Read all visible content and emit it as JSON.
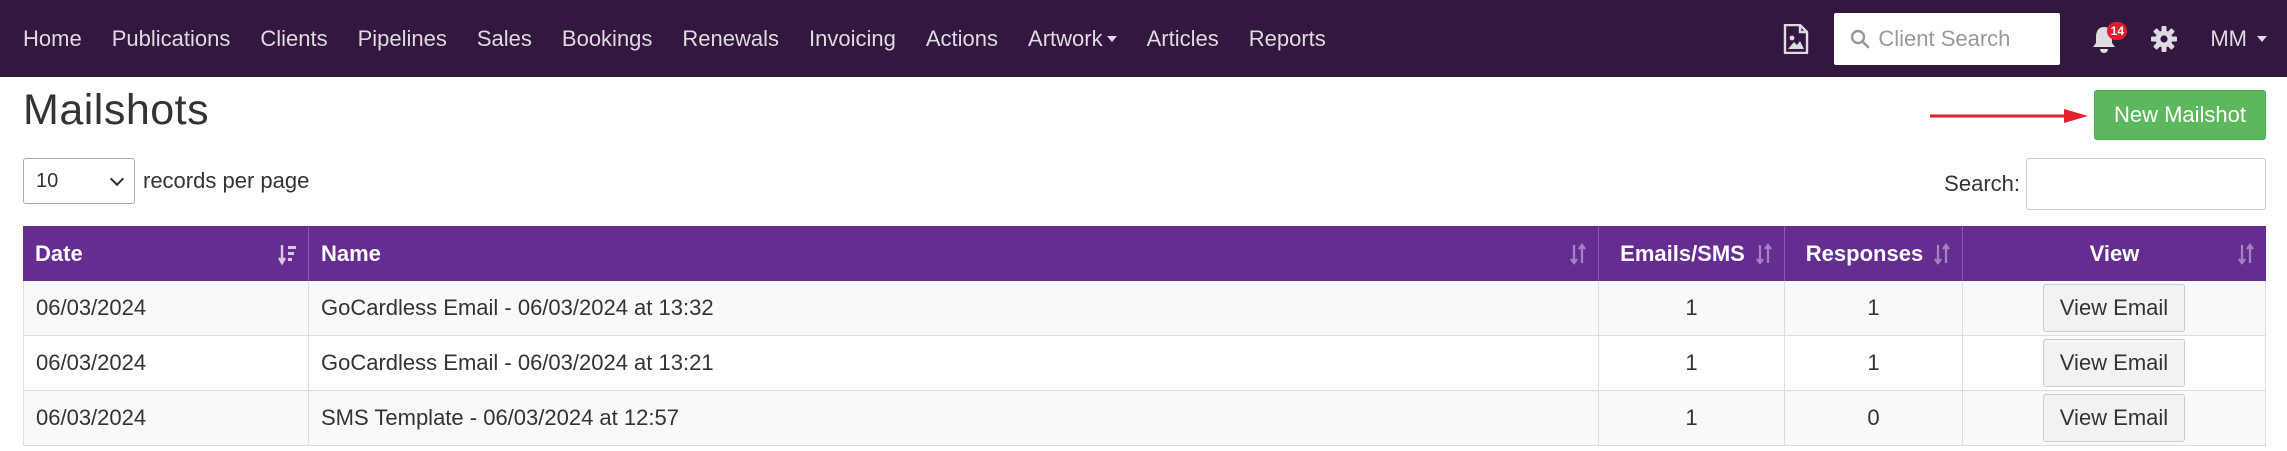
{
  "nav": {
    "items": [
      {
        "label": "Home"
      },
      {
        "label": "Publications"
      },
      {
        "label": "Clients"
      },
      {
        "label": "Pipelines"
      },
      {
        "label": "Sales"
      },
      {
        "label": "Bookings"
      },
      {
        "label": "Renewals"
      },
      {
        "label": "Invoicing"
      },
      {
        "label": "Actions"
      },
      {
        "label": "Artwork",
        "has_dropdown": true
      },
      {
        "label": "Articles"
      },
      {
        "label": "Reports"
      }
    ],
    "client_search_placeholder": "Client Search",
    "notification_count": "14",
    "user_initials": "MM",
    "icons": [
      "image-file-icon",
      "search-icon",
      "bell-icon",
      "gear-icon"
    ]
  },
  "page": {
    "title": "Mailshots",
    "new_button": "New Mailshot"
  },
  "controls": {
    "length_value": "10",
    "length_label": "records per page",
    "search_label": "Search:"
  },
  "table": {
    "headers": [
      "Date",
      "Name",
      "Emails/SMS",
      "Responses",
      "View"
    ],
    "rows": [
      {
        "date": "06/03/2024",
        "name": "GoCardless Email - 06/03/2024 at 13:32",
        "emails": "1",
        "responses": "1",
        "view": "View Email"
      },
      {
        "date": "06/03/2024",
        "name": "GoCardless Email - 06/03/2024 at 13:21",
        "emails": "1",
        "responses": "1",
        "view": "View Email"
      },
      {
        "date": "06/03/2024",
        "name": "SMS Template - 06/03/2024 at 12:57",
        "emails": "1",
        "responses": "0",
        "view": "View Email"
      }
    ]
  },
  "colors": {
    "navbar": "#33173f",
    "table_header": "#662d91",
    "primary_button": "#5cb85c",
    "arrow": "#e0202c",
    "badge": "#e01e2f"
  }
}
